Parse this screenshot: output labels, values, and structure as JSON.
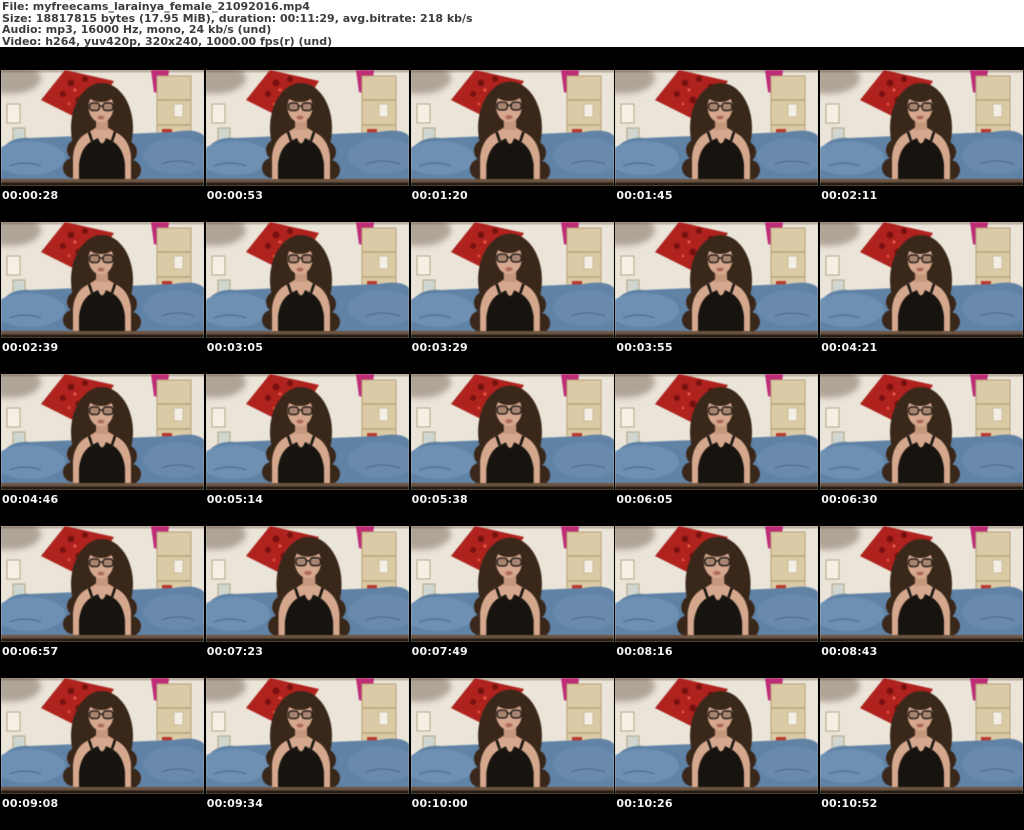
{
  "header": {
    "lines": [
      "File: myfreecams_larainya_female_21092016.mp4",
      "Size: 18817815 bytes (17.95 MiB), duration: 00:11:29, avg.bitrate: 218 kb/s",
      "Audio: mp3, 16000 Hz, mono, 24 kb/s (und)",
      "Video: h264, yuv420p, 320x240, 1000.00 fps(r) (und)"
    ]
  },
  "thumbnails": [
    {
      "timestamp": "00:00:28"
    },
    {
      "timestamp": "00:00:53"
    },
    {
      "timestamp": "00:01:20"
    },
    {
      "timestamp": "00:01:45"
    },
    {
      "timestamp": "00:02:11"
    },
    {
      "timestamp": "00:02:39"
    },
    {
      "timestamp": "00:03:05"
    },
    {
      "timestamp": "00:03:29"
    },
    {
      "timestamp": "00:03:55"
    },
    {
      "timestamp": "00:04:21"
    },
    {
      "timestamp": "00:04:46"
    },
    {
      "timestamp": "00:05:14"
    },
    {
      "timestamp": "00:05:38"
    },
    {
      "timestamp": "00:06:05"
    },
    {
      "timestamp": "00:06:30"
    },
    {
      "timestamp": "00:06:57"
    },
    {
      "timestamp": "00:07:23"
    },
    {
      "timestamp": "00:07:49"
    },
    {
      "timestamp": "00:08:16"
    },
    {
      "timestamp": "00:08:43"
    },
    {
      "timestamp": "00:09:08"
    },
    {
      "timestamp": "00:09:34"
    },
    {
      "timestamp": "00:10:00"
    },
    {
      "timestamp": "00:10:26"
    },
    {
      "timestamp": "00:10:52"
    }
  ],
  "colors": {
    "page_bg": "#000000",
    "header_bg": "#ffffff",
    "header_text": "#3c3c3c",
    "timestamp_text": "#f4f4f4",
    "wall": "#eae4d8",
    "couch": "#5d82a8",
    "cloth_red": "#b6201c",
    "accent_pink": "#c42a78",
    "hair": "#3a2719",
    "skin": "#d7a88c",
    "top_black": "#17140f",
    "shelf": "#dccaa4"
  }
}
